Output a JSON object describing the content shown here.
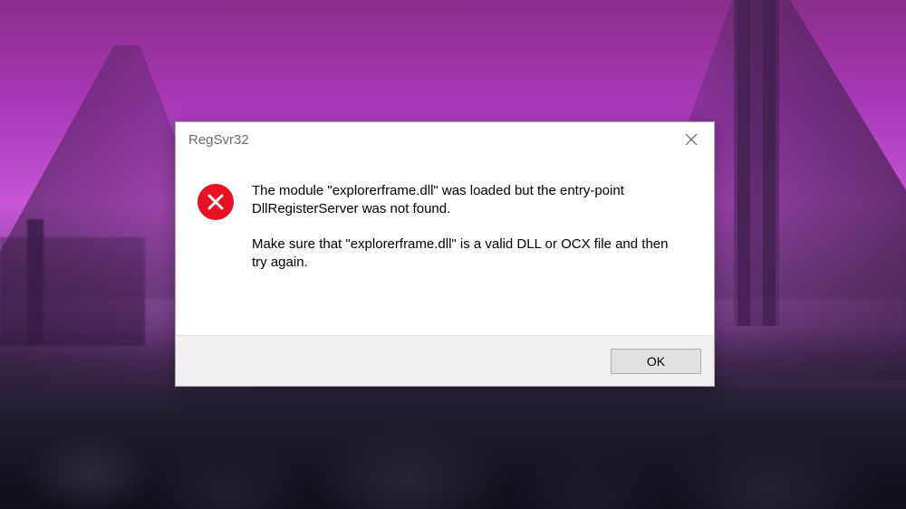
{
  "dialog": {
    "title": "RegSvr32",
    "message_line1": "The module \"explorerframe.dll\" was loaded but the entry-point DllRegisterServer was not found.",
    "message_line2": "Make sure that \"explorerframe.dll\" is a valid DLL or OCX file and then try again.",
    "ok_label": "OK"
  }
}
